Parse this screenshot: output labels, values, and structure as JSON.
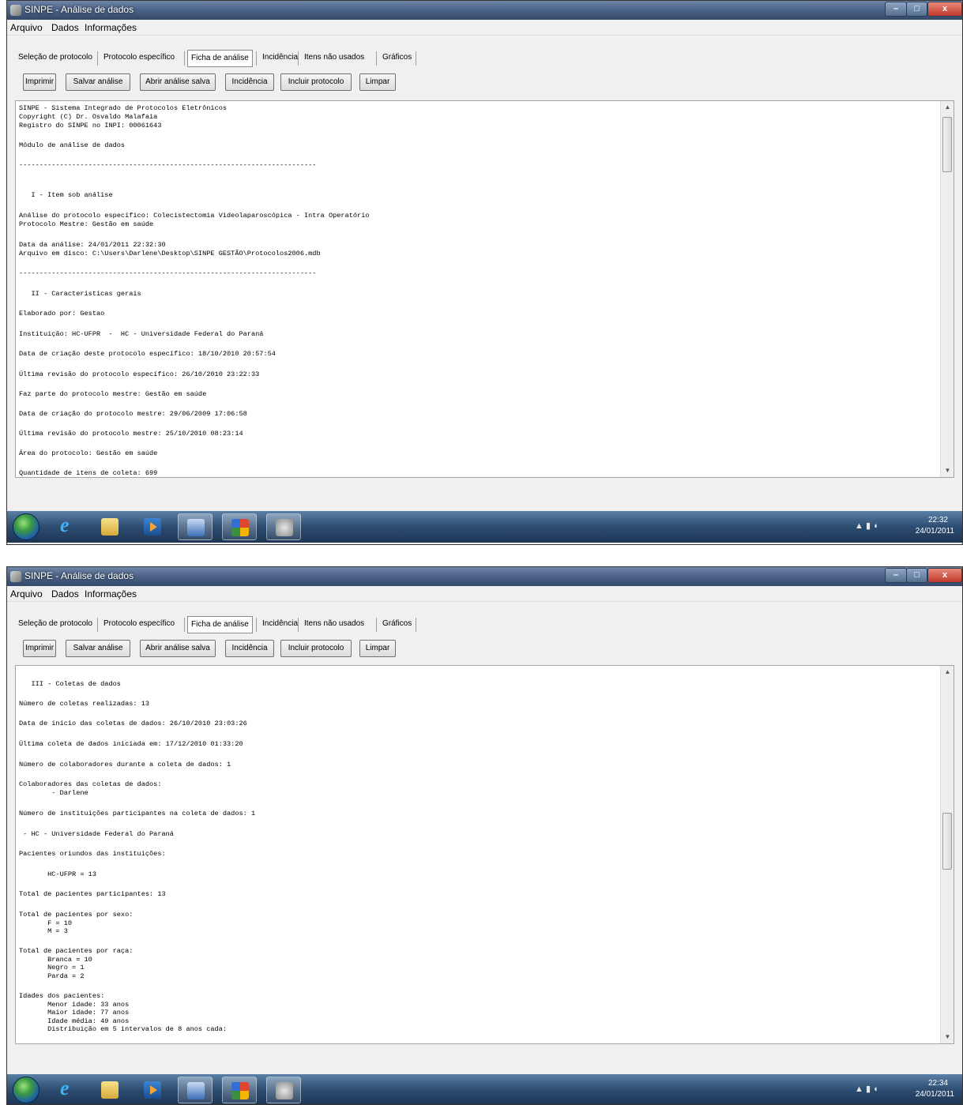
{
  "screens": [
    {
      "window_title": "SINPE - Análise de dados",
      "menu": [
        "Arquivo",
        "Dados",
        "Informações"
      ],
      "tabs": [
        "Seleção de protocolo",
        "Protocolo específico",
        "Ficha de análise",
        "Incidência",
        "Itens não usados",
        "Gráficos"
      ],
      "active_tab": "Ficha de análise",
      "buttons": [
        "Imprimir",
        "Salvar análise",
        "Abrir análise salva",
        "Incidência",
        "Incluir protocolo",
        "Limpar"
      ],
      "text_lines": [
        "SINPE - Sistema Integrado de Protocolos Eletrônicos",
        "Copyright (C) Dr. Osvaldo Malafaia",
        "Registro do SINPE no INPI: 00061643",
        "Módulo de análise de dados",
        "-------------------------------------------------------------------------",
        "   I - Item sob análise",
        "Análise do protocolo específico: Colecistectomia Videolaparoscópica - Intra Operatório",
        "Protocolo Mestre: Gestão em saúde",
        "Data da análise: 24/01/2011 22:32:30",
        "Arquivo em disco: C:\\Users\\Darlene\\Desktop\\SINPE GESTÃO\\Protocolos2006.mdb",
        "-------------------------------------------------------------------------",
        "   II - Características gerais",
        "Elaborado por: Gestao",
        "Instituição: HC-UFPR  -  HC - Universidade Federal do Paraná",
        "Data de criação deste protocolo específico: 18/10/2010 20:57:54",
        "Última revisão do protocolo específico: 26/10/2010 23:22:33",
        "Faz parte do protocolo mestre: Gestão em saúde",
        "Data de criação do protocolo mestre: 29/06/2009 17:06:58",
        "Última revisão do protocolo mestre: 25/10/2010 08:23:14",
        "Área do protocolo: Gestão em saúde",
        "Quantidade de itens de coleta: 699"
      ],
      "clock_time": "22:32",
      "clock_date": "24/01/2011",
      "tray_icons": "▲  ▮  ◖"
    },
    {
      "window_title": "SINPE - Análise de dados",
      "menu": [
        "Arquivo",
        "Dados",
        "Informações"
      ],
      "tabs": [
        "Seleção de protocolo",
        "Protocolo específico",
        "Ficha de análise",
        "Incidência",
        "Itens não usados",
        "Gráficos"
      ],
      "active_tab": "Ficha de análise",
      "buttons": [
        "Imprimir",
        "Salvar análise",
        "Abrir análise salva",
        "Incidência",
        "Incluir protocolo",
        "Limpar"
      ],
      "text_lines": [
        "   III - Coletas de dados",
        "Número de coletas realizadas: 13",
        "Data de início das coletas de dados: 26/10/2010 23:03:26",
        "Última coleta de dados iniciada em: 17/12/2010 01:33:20",
        "Número de colaboradores durante a coleta de dados: 1",
        "Colaboradores das coletas de dados:",
        "        - Darlene",
        "Número de instituições participantes na coleta de dados: 1",
        " - HC - Universidade Federal do Paraná",
        "Pacientes oriundos das instituições:",
        "       HC-UFPR = 13",
        "Total de pacientes participantes: 13",
        "Total de pacientes por sexo:",
        "       F = 10",
        "       M = 3",
        "Total de pacientes por raça:",
        "       Branca = 10",
        "       Negro = 1",
        "       Parda = 2",
        "Idades dos pacientes:",
        "       Menor idade: 33 anos",
        "       Maior idade: 77 anos",
        "       Idade média: 49 anos",
        "       Distribuição em 5 intervalos de 8 anos cada:"
      ],
      "clock_time": "22:34",
      "clock_date": "24/01/2011",
      "tray_icons": "▲  ▮  ◖"
    }
  ],
  "icons": {
    "window_controls": [
      "minimize-icon",
      "maximize-icon",
      "close-icon"
    ],
    "taskbar": [
      "start-orb-icon",
      "internet-explorer-icon",
      "file-explorer-icon",
      "media-player-icon",
      "word-icon",
      "office-icon",
      "sinpe-app-icon"
    ]
  },
  "glyphs": {
    "minimize": "–",
    "maximize": "□",
    "close": "x",
    "ie": "e",
    "scroll_up": "▲",
    "scroll_down": "▼"
  }
}
